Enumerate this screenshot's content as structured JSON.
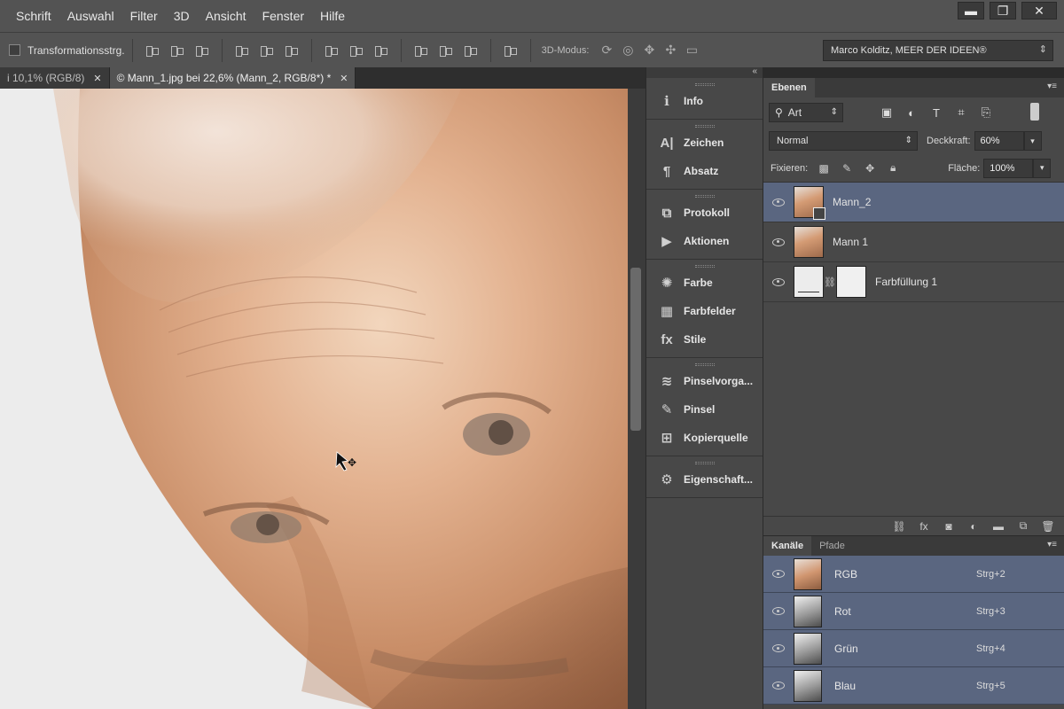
{
  "menu": [
    "Schrift",
    "Auswahl",
    "Filter",
    "3D",
    "Ansicht",
    "Fenster",
    "Hilfe"
  ],
  "window_controls": {
    "minimize": "▬",
    "maximize": "❐",
    "close": "✕"
  },
  "options_bar": {
    "transform_label": "Transformationsstrg.",
    "mode_label": "3D-Modus:",
    "workspace": "Marco Kolditz, MEER DER IDEEN®"
  },
  "doc_tabs": [
    {
      "label": "i 10,1% (RGB/8)",
      "active": false
    },
    {
      "label": "© Mann_1.jpg bei 22,6% (Mann_2, RGB/8*) *",
      "active": true
    }
  ],
  "dock": {
    "groups": [
      [
        {
          "label": "Info",
          "icon": "info-icon",
          "glyph": "ℹ"
        }
      ],
      [
        {
          "label": "Zeichen",
          "icon": "character-icon",
          "glyph": "A|"
        },
        {
          "label": "Absatz",
          "icon": "paragraph-icon",
          "glyph": "¶"
        }
      ],
      [
        {
          "label": "Protokoll",
          "icon": "history-icon",
          "glyph": "⧉"
        },
        {
          "label": "Aktionen",
          "icon": "actions-icon",
          "glyph": "▶"
        }
      ],
      [
        {
          "label": "Farbe",
          "icon": "color-icon",
          "glyph": "✺"
        },
        {
          "label": "Farbfelder",
          "icon": "swatches-icon",
          "glyph": "▦"
        },
        {
          "label": "Stile",
          "icon": "styles-icon",
          "glyph": "fx"
        }
      ],
      [
        {
          "label": "Pinselvorga...",
          "icon": "brush-presets-icon",
          "glyph": "≋"
        },
        {
          "label": "Pinsel",
          "icon": "brush-icon",
          "glyph": "✎"
        },
        {
          "label": "Kopierquelle",
          "icon": "clone-source-icon",
          "glyph": "⊞"
        }
      ],
      [
        {
          "label": "Eigenschaft...",
          "icon": "properties-icon",
          "glyph": "⚙"
        }
      ]
    ]
  },
  "layers": {
    "tab_active": "Ebenen",
    "filter_kind": "Art",
    "blend_mode": "Normal",
    "opacity_label": "Deckkraft:",
    "opacity": "60%",
    "lock_label": "Fixieren:",
    "fill_label": "Fläche:",
    "fill": "100%",
    "items": [
      {
        "name": "Mann_2",
        "selected": true,
        "type": "smart"
      },
      {
        "name": "Mann 1",
        "selected": false,
        "type": "photo"
      },
      {
        "name": "Farbfüllung 1",
        "selected": false,
        "type": "fill"
      }
    ]
  },
  "channels": {
    "tabs": [
      "Kanäle",
      "Pfade"
    ],
    "items": [
      {
        "name": "RGB",
        "shortcut": "Strg+2",
        "tone": "rgb"
      },
      {
        "name": "Rot",
        "shortcut": "Strg+3",
        "tone": "gray"
      },
      {
        "name": "Grün",
        "shortcut": "Strg+4",
        "tone": "gray"
      },
      {
        "name": "Blau",
        "shortcut": "Strg+5",
        "tone": "gray"
      }
    ]
  },
  "colors": {
    "selection": "#5a6680",
    "panel": "#484848",
    "menubar": "#535353"
  }
}
